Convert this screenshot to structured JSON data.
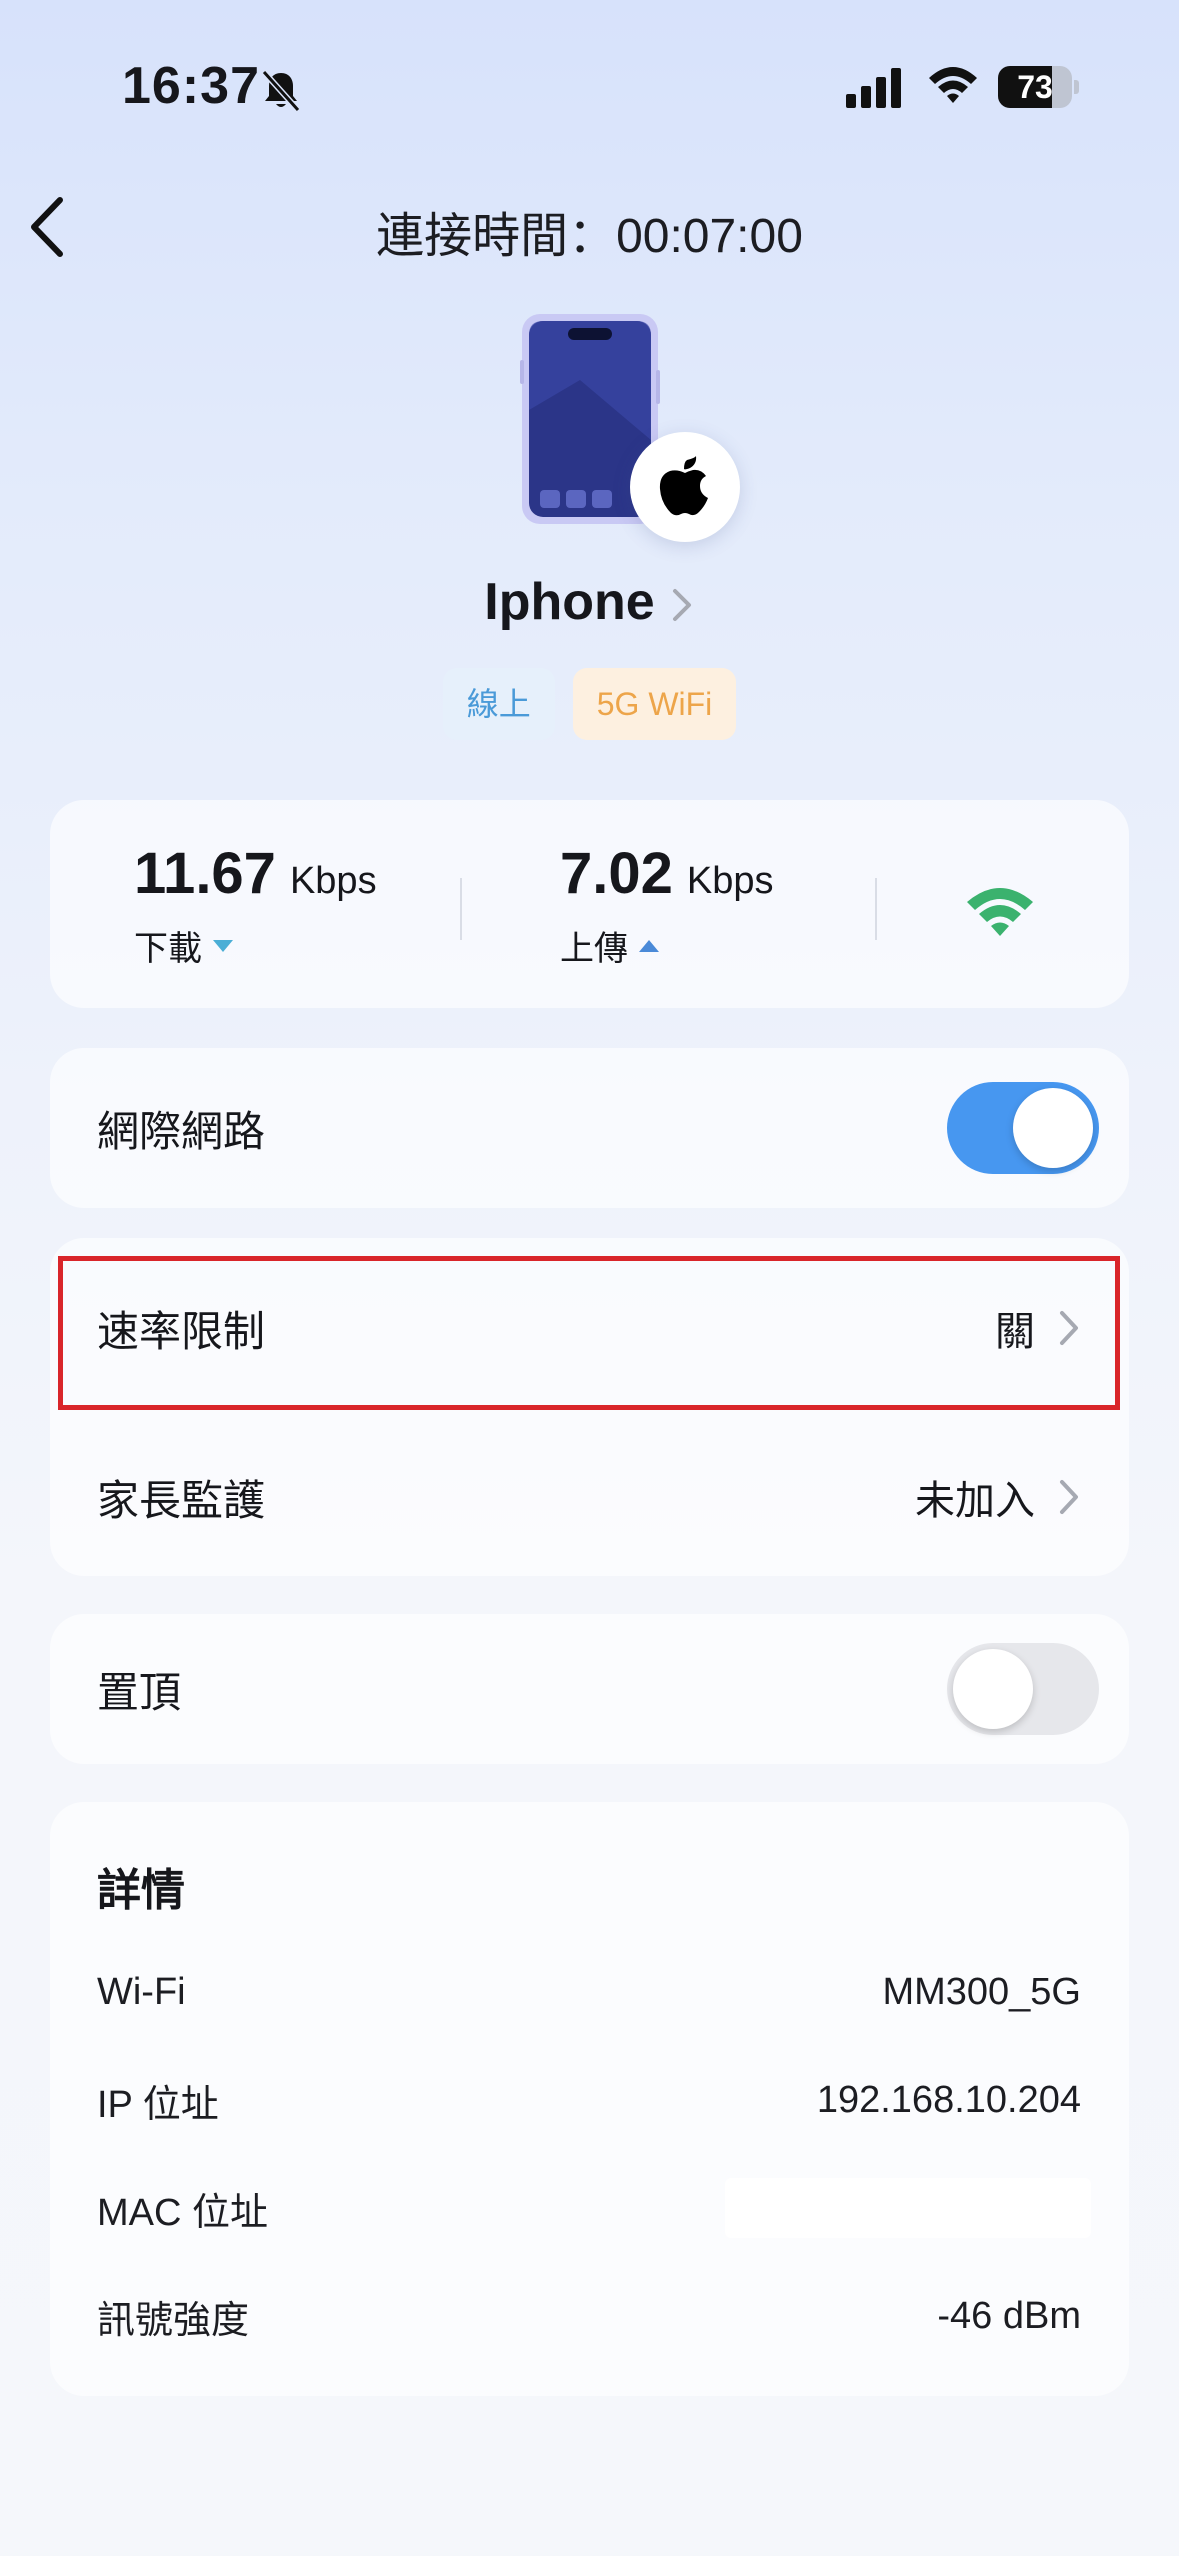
{
  "status_bar": {
    "time": "16:37",
    "battery_level": "73",
    "battery_fraction": 0.73
  },
  "header": {
    "title": "連接時間：00:07:00"
  },
  "device": {
    "name": "Iphone",
    "tags": [
      "線上",
      "5G WiFi"
    ]
  },
  "speed": {
    "download_value": "11.67",
    "download_unit": "Kbps",
    "download_label": "下載",
    "upload_value": "7.02",
    "upload_unit": "Kbps",
    "upload_label": "上傳",
    "signal_color": "#3bb26e"
  },
  "settings": {
    "internet_label": "網際網路",
    "internet_on": true,
    "rate_limit_label": "速率限制",
    "rate_limit_value": "關",
    "parental_label": "家長監護",
    "parental_value": "未加入",
    "pin_top_label": "置頂",
    "pin_top_on": false
  },
  "details": {
    "title": "詳情",
    "rows": [
      {
        "label": "Wi-Fi",
        "value": "MM300_5G"
      },
      {
        "label": "IP 位址",
        "value": "192.168.10.204"
      },
      {
        "label": "MAC 位址",
        "value": ""
      },
      {
        "label": "訊號強度",
        "value": "-46 dBm"
      }
    ]
  },
  "colors": {
    "accent_blue": "#4797f0",
    "online_tag": "#4a9ad8",
    "band_tag": "#eda54a",
    "highlight_red": "#d9252a"
  }
}
